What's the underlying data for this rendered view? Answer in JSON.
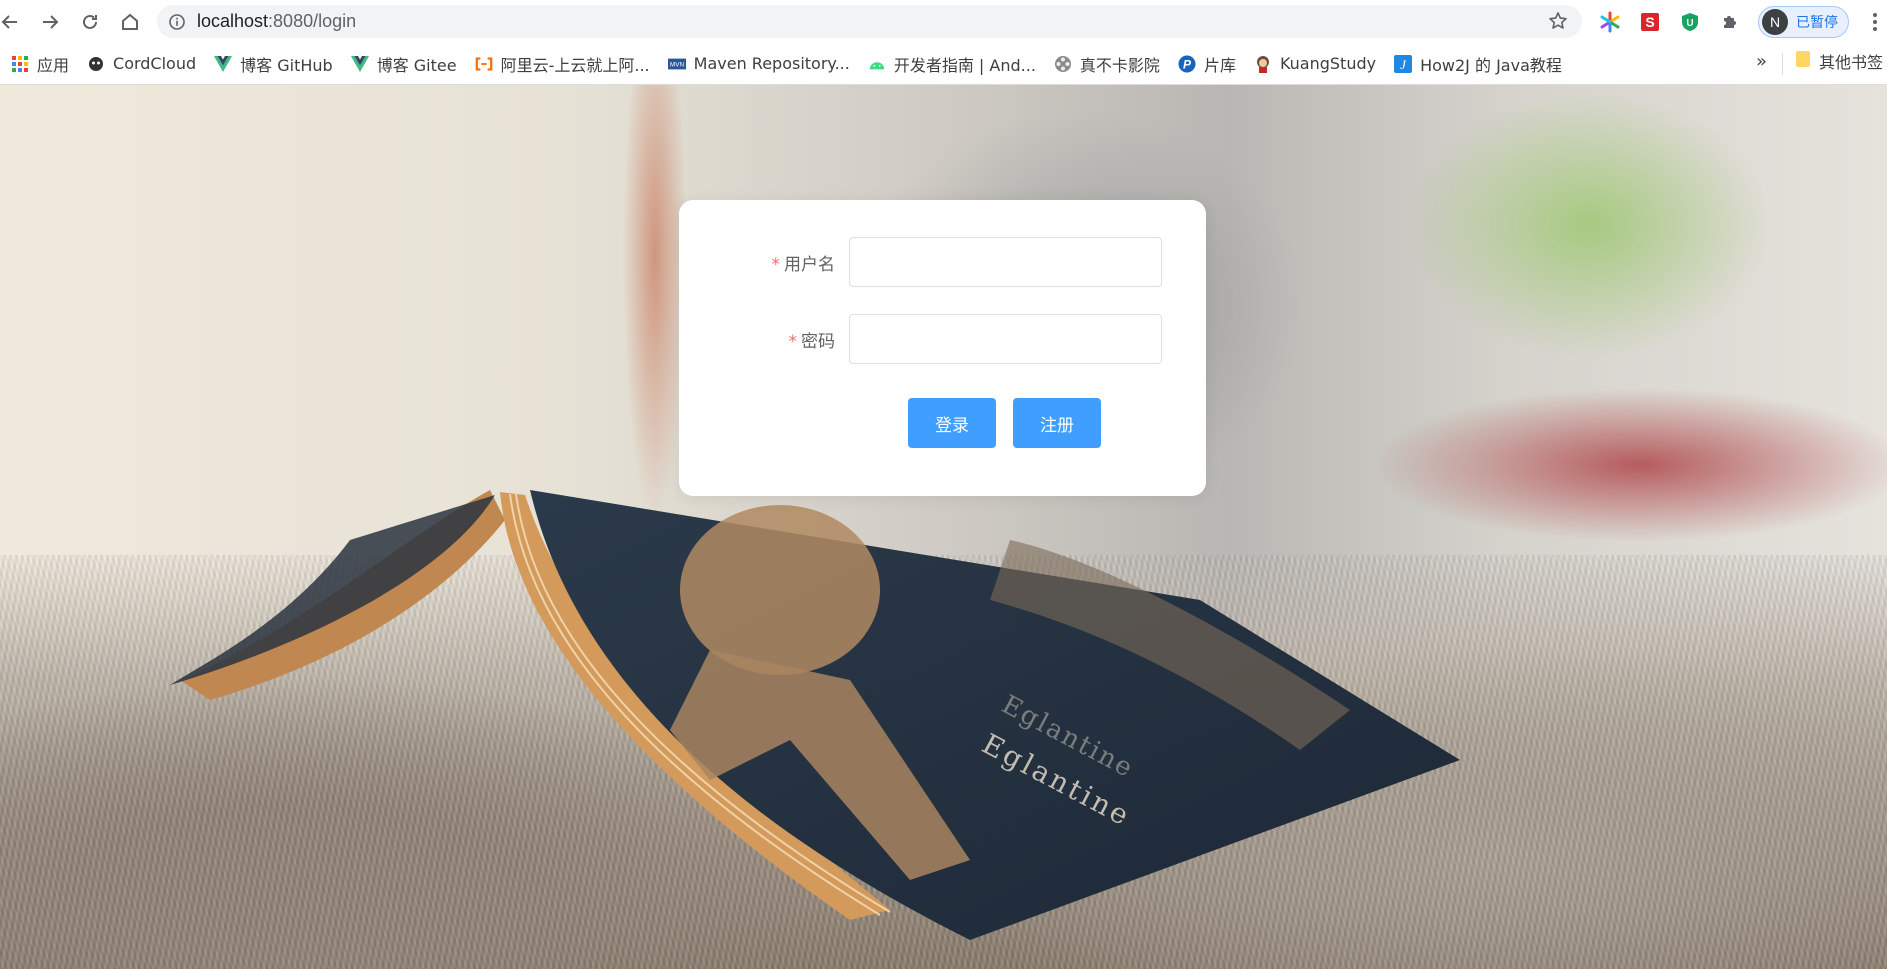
{
  "browser": {
    "url_host": "localhost",
    "url_path": ":8080/login",
    "profile_initial": "N",
    "profile_status": "已暂停",
    "bookmarks": [
      {
        "label": "应用",
        "icon": "apps-grid-icon"
      },
      {
        "label": "CordCloud",
        "icon": "cordcloud-icon"
      },
      {
        "label": "博客 GitHub",
        "icon": "vue-icon"
      },
      {
        "label": "博客 Gitee",
        "icon": "vue-icon"
      },
      {
        "label": "阿里云-上云就上阿...",
        "icon": "aliyun-icon"
      },
      {
        "label": "Maven Repository...",
        "icon": "mvn-icon"
      },
      {
        "label": "开发者指南 | And...",
        "icon": "android-icon"
      },
      {
        "label": "真不卡影院",
        "icon": "film-reel-icon"
      },
      {
        "label": "片库",
        "icon": "p-icon"
      },
      {
        "label": "KuangStudy",
        "icon": "mascot-icon"
      },
      {
        "label": "How2J 的 Java教程",
        "icon": "how2j-icon"
      }
    ],
    "bookmarks_overflow": "»",
    "other_bookmarks": "其他书签",
    "colors": {
      "accent": "#1a73e8",
      "toolbar_bg": "#ffffff",
      "omnibox_bg": "#f1f3f4"
    }
  },
  "background": {
    "book_title_line1": "Eglantine",
    "book_title_line2": "Eglantine"
  },
  "login": {
    "username_label": "用户名",
    "password_label": "密码",
    "required_mark": "*",
    "username_value": "",
    "password_value": "",
    "login_button": "登录",
    "register_button": "注册",
    "colors": {
      "primary": "#409eff",
      "required": "#f56c6c",
      "label": "#606266"
    }
  }
}
